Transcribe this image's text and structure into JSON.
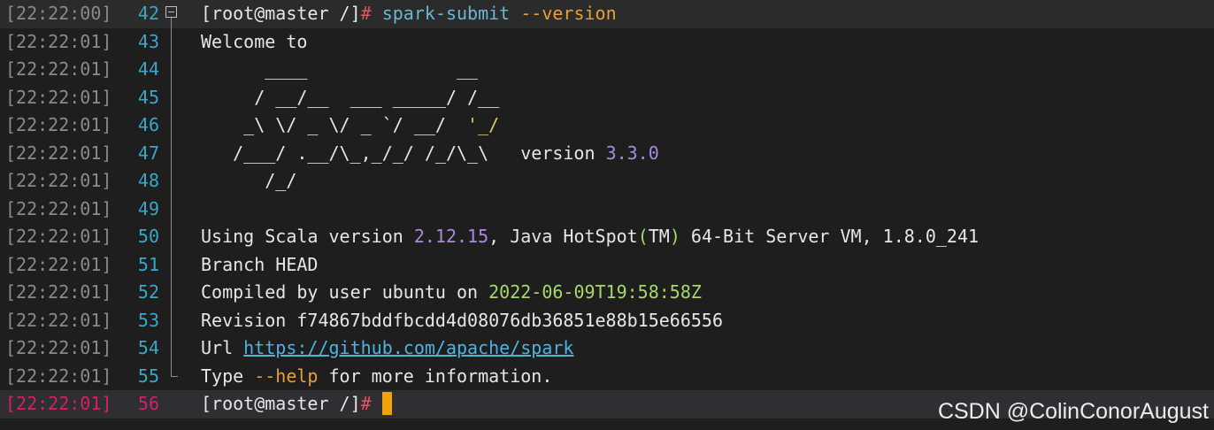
{
  "terminal": {
    "lines": [
      {
        "ts": "[22:22:00]",
        "ln": "42",
        "segments": [
          {
            "t": "[root@master /]",
            "c": "white"
          },
          {
            "t": "# ",
            "c": "red"
          },
          {
            "t": "spark-submit ",
            "c": "blue"
          },
          {
            "t": "--version",
            "c": "orange"
          }
        ]
      },
      {
        "ts": "[22:22:01]",
        "ln": "43",
        "segments": [
          {
            "t": "Welcome to",
            "c": "white"
          }
        ]
      },
      {
        "ts": "[22:22:01]",
        "ln": "44",
        "segments": [
          {
            "t": "      ____              __",
            "c": "white"
          }
        ]
      },
      {
        "ts": "[22:22:01]",
        "ln": "45",
        "segments": [
          {
            "t": "     / __/__  ___ _____/ /__",
            "c": "white"
          }
        ]
      },
      {
        "ts": "[22:22:01]",
        "ln": "46",
        "segments": [
          {
            "t": "    _\\ \\/ _ \\/ _ `/ __/  ",
            "c": "white"
          },
          {
            "t": "'_/",
            "c": "yellow"
          }
        ]
      },
      {
        "ts": "[22:22:01]",
        "ln": "47",
        "segments": [
          {
            "t": "   /___/ .__/\\_,_/_/ /_/\\_\\   version ",
            "c": "white"
          },
          {
            "t": "3.3.0",
            "c": "purple"
          }
        ]
      },
      {
        "ts": "[22:22:01]",
        "ln": "48",
        "segments": [
          {
            "t": "      /_/",
            "c": "white"
          }
        ]
      },
      {
        "ts": "[22:22:01]",
        "ln": "49",
        "segments": []
      },
      {
        "ts": "[22:22:01]",
        "ln": "50",
        "segments": [
          {
            "t": "Using Scala version ",
            "c": "white"
          },
          {
            "t": "2.12.15",
            "c": "purple"
          },
          {
            "t": ", Java HotSpot",
            "c": "white"
          },
          {
            "t": "(",
            "c": "green"
          },
          {
            "t": "TM",
            "c": "white"
          },
          {
            "t": ")",
            "c": "green"
          },
          {
            "t": " 64-Bit Server VM, 1.8.0_241",
            "c": "white"
          }
        ]
      },
      {
        "ts": "[22:22:01]",
        "ln": "51",
        "segments": [
          {
            "t": "Branch HEAD",
            "c": "white"
          }
        ]
      },
      {
        "ts": "[22:22:01]",
        "ln": "52",
        "segments": [
          {
            "t": "Compiled by user ubuntu on ",
            "c": "white"
          },
          {
            "t": "2022-06-09T19:58:58Z",
            "c": "green"
          }
        ]
      },
      {
        "ts": "[22:22:01]",
        "ln": "53",
        "segments": [
          {
            "t": "Revision f74867bddfbcdd4d08076db36851e88b15e66556",
            "c": "white"
          }
        ]
      },
      {
        "ts": "[22:22:01]",
        "ln": "54",
        "segments": [
          {
            "t": "Url ",
            "c": "white"
          },
          {
            "t": "https://github.com/apache/spark",
            "c": "link"
          }
        ]
      },
      {
        "ts": "[22:22:01]",
        "ln": "55",
        "segments": [
          {
            "t": "Type ",
            "c": "white"
          },
          {
            "t": "--help",
            "c": "orange"
          },
          {
            "t": " for more information.",
            "c": "white"
          }
        ]
      },
      {
        "ts": "[22:22:01]",
        "ln": "56",
        "current": true,
        "segments": [
          {
            "t": "[root@master /]",
            "c": "white"
          },
          {
            "t": "#",
            "c": "red"
          }
        ]
      }
    ]
  },
  "watermark": "CSDN @ColinConorAugust",
  "colors": {
    "background": "#1e1e1e",
    "timestamp": "#8a8a8a",
    "line_number": "#3aa6c8",
    "current_marker": "#d61f69",
    "cursor": "#f0a30a"
  }
}
